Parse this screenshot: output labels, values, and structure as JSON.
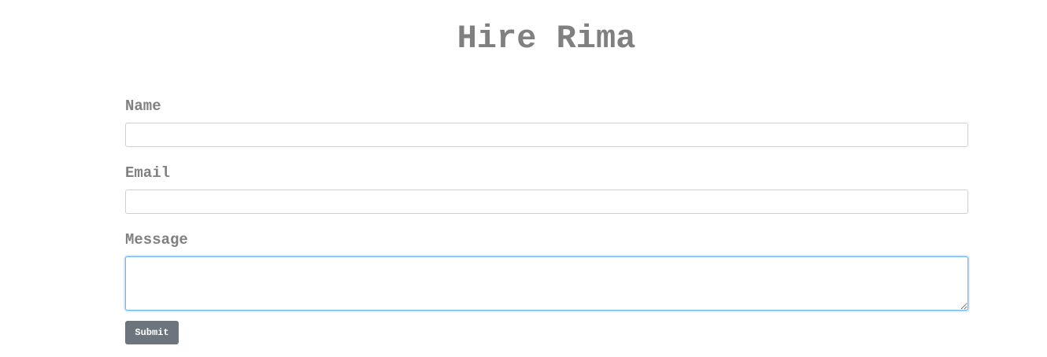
{
  "page": {
    "title": "Hire Rima"
  },
  "form": {
    "name": {
      "label": "Name",
      "value": "",
      "placeholder": ""
    },
    "email": {
      "label": "Email",
      "value": "",
      "placeholder": ""
    },
    "message": {
      "label": "Message",
      "value": "",
      "placeholder": ""
    },
    "submit_label": "Submit"
  },
  "colors": {
    "text": "#808080",
    "button_background": "#6c757d",
    "button_text": "#ffffff",
    "focus_border": "#6fb4ee"
  }
}
